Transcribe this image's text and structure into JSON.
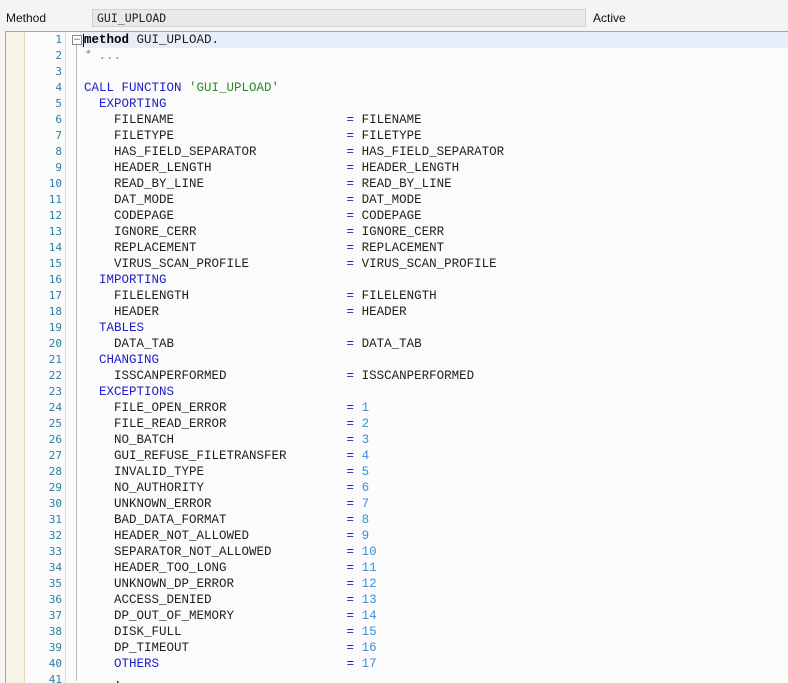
{
  "header": {
    "method_label": "Method",
    "method_value": "GUI_UPLOAD",
    "status": "Active"
  },
  "editor": {
    "lines": [
      {
        "n": "1",
        "t": "method GUI_UPLOAD."
      },
      {
        "n": "2",
        "t": "* ..."
      },
      {
        "n": "3",
        "t": ""
      },
      {
        "n": "4",
        "t": "CALL FUNCTION 'GUI_UPLOAD'"
      },
      {
        "n": "5",
        "t": "  EXPORTING"
      },
      {
        "n": "6",
        "t": "    FILENAME                       = FILENAME"
      },
      {
        "n": "7",
        "t": "    FILETYPE                       = FILETYPE"
      },
      {
        "n": "8",
        "t": "    HAS_FIELD_SEPARATOR            = HAS_FIELD_SEPARATOR"
      },
      {
        "n": "9",
        "t": "    HEADER_LENGTH                  = HEADER_LENGTH"
      },
      {
        "n": "10",
        "t": "    READ_BY_LINE                   = READ_BY_LINE"
      },
      {
        "n": "11",
        "t": "    DAT_MODE                       = DAT_MODE"
      },
      {
        "n": "12",
        "t": "    CODEPAGE                       = CODEPAGE"
      },
      {
        "n": "13",
        "t": "    IGNORE_CERR                    = IGNORE_CERR"
      },
      {
        "n": "14",
        "t": "    REPLACEMENT                    = REPLACEMENT"
      },
      {
        "n": "15",
        "t": "    VIRUS_SCAN_PROFILE             = VIRUS_SCAN_PROFILE"
      },
      {
        "n": "16",
        "t": "  IMPORTING"
      },
      {
        "n": "17",
        "t": "    FILELENGTH                     = FILELENGTH"
      },
      {
        "n": "18",
        "t": "    HEADER                         = HEADER"
      },
      {
        "n": "19",
        "t": "  TABLES"
      },
      {
        "n": "20",
        "t": "    DATA_TAB                       = DATA_TAB"
      },
      {
        "n": "21",
        "t": "  CHANGING"
      },
      {
        "n": "22",
        "t": "    ISSCANPERFORMED                = ISSCANPERFORMED"
      },
      {
        "n": "23",
        "t": "  EXCEPTIONS"
      },
      {
        "n": "24",
        "t": "    FILE_OPEN_ERROR                = 1"
      },
      {
        "n": "25",
        "t": "    FILE_READ_ERROR                = 2"
      },
      {
        "n": "26",
        "t": "    NO_BATCH                       = 3"
      },
      {
        "n": "27",
        "t": "    GUI_REFUSE_FILETRANSFER        = 4"
      },
      {
        "n": "28",
        "t": "    INVALID_TYPE                   = 5"
      },
      {
        "n": "29",
        "t": "    NO_AUTHORITY                   = 6"
      },
      {
        "n": "30",
        "t": "    UNKNOWN_ERROR                  = 7"
      },
      {
        "n": "31",
        "t": "    BAD_DATA_FORMAT                = 8"
      },
      {
        "n": "32",
        "t": "    HEADER_NOT_ALLOWED             = 9"
      },
      {
        "n": "33",
        "t": "    SEPARATOR_NOT_ALLOWED          = 10"
      },
      {
        "n": "34",
        "t": "    HEADER_TOO_LONG                = 11"
      },
      {
        "n": "35",
        "t": "    UNKNOWN_DP_ERROR               = 12"
      },
      {
        "n": "36",
        "t": "    ACCESS_DENIED                  = 13"
      },
      {
        "n": "37",
        "t": "    DP_OUT_OF_MEMORY               = 14"
      },
      {
        "n": "38",
        "t": "    DISK_FULL                      = 15"
      },
      {
        "n": "39",
        "t": "    DP_TIMEOUT                     = 16"
      },
      {
        "n": "40",
        "t": "    OTHERS                         = 17"
      },
      {
        "n": "41",
        "t": "    ."
      }
    ]
  }
}
